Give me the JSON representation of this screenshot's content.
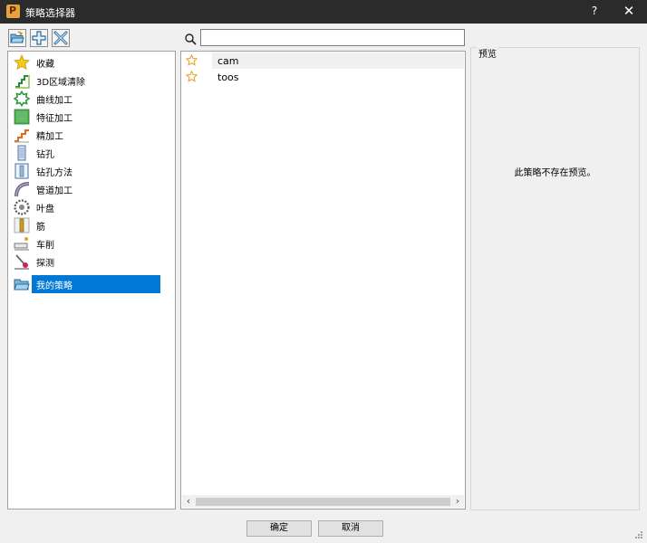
{
  "window": {
    "title": "策略选择器",
    "help_label": "?",
    "close_label": "✕"
  },
  "toolbar": {
    "buttons": [
      "open-folder-icon",
      "add-icon",
      "edit-icon"
    ]
  },
  "search": {
    "value": "",
    "placeholder": ""
  },
  "categories": [
    {
      "label": "收藏",
      "icon": "star-icon"
    },
    {
      "label": "3D区域清除",
      "icon": "area-clearance-icon"
    },
    {
      "label": "曲线加工",
      "icon": "curve-machining-icon"
    },
    {
      "label": "特征加工",
      "icon": "feature-machining-icon"
    },
    {
      "label": "精加工",
      "icon": "finishing-icon"
    },
    {
      "label": "钻孔",
      "icon": "drilling-icon"
    },
    {
      "label": "钻孔方法",
      "icon": "drilling-method-icon"
    },
    {
      "label": "管道加工",
      "icon": "pipe-machining-icon"
    },
    {
      "label": "叶盘",
      "icon": "blisk-icon"
    },
    {
      "label": "筋",
      "icon": "rib-icon"
    },
    {
      "label": "车削",
      "icon": "turning-icon"
    },
    {
      "label": "探测",
      "icon": "probing-icon"
    },
    {
      "label": "我的策略",
      "icon": "my-strategies-folder-icon",
      "selected": true
    }
  ],
  "strategies": [
    {
      "name": "cam",
      "favorite": false
    },
    {
      "name": "toos",
      "favorite": false
    }
  ],
  "scrollbar": {
    "left_arrow": "‹",
    "right_arrow": "›"
  },
  "preview": {
    "title": "预览",
    "message": "此策略不存在预览。"
  },
  "buttons": {
    "ok": "确定",
    "cancel": "取消"
  },
  "colors": {
    "titlebar": "#2b2b2b",
    "selection": "#0078d7",
    "star_outline": "#e8a020"
  }
}
